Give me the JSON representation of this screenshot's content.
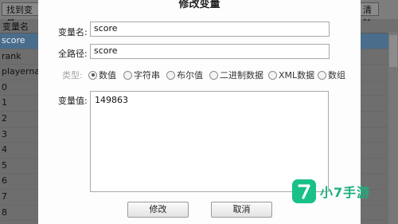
{
  "background": {
    "toolbar": {
      "find_button": "找到变量",
      "clear_button": "清除"
    },
    "list": {
      "header": "变量名",
      "rows": [
        "score",
        "rank",
        "playernam",
        "0",
        "1",
        "2",
        "3",
        "4",
        "5",
        "6",
        "7",
        "8"
      ],
      "selected": "score"
    }
  },
  "dialog": {
    "title": "修改变量",
    "name_label": "变量名:",
    "name_value": "score",
    "path_label": "全路径:",
    "path_value": "score",
    "type_label": "类型:",
    "types": [
      "数值",
      "字符串",
      "布尔值",
      "二进制数据",
      "XML数据",
      "数组"
    ],
    "selected_type": "数值",
    "value_label": "变量值:",
    "value": "149863",
    "modify_button": "修改",
    "cancel_button": "取消"
  },
  "watermark": {
    "icon": "brand-7-icon",
    "text": "小7手游",
    "color": "#19c087"
  }
}
